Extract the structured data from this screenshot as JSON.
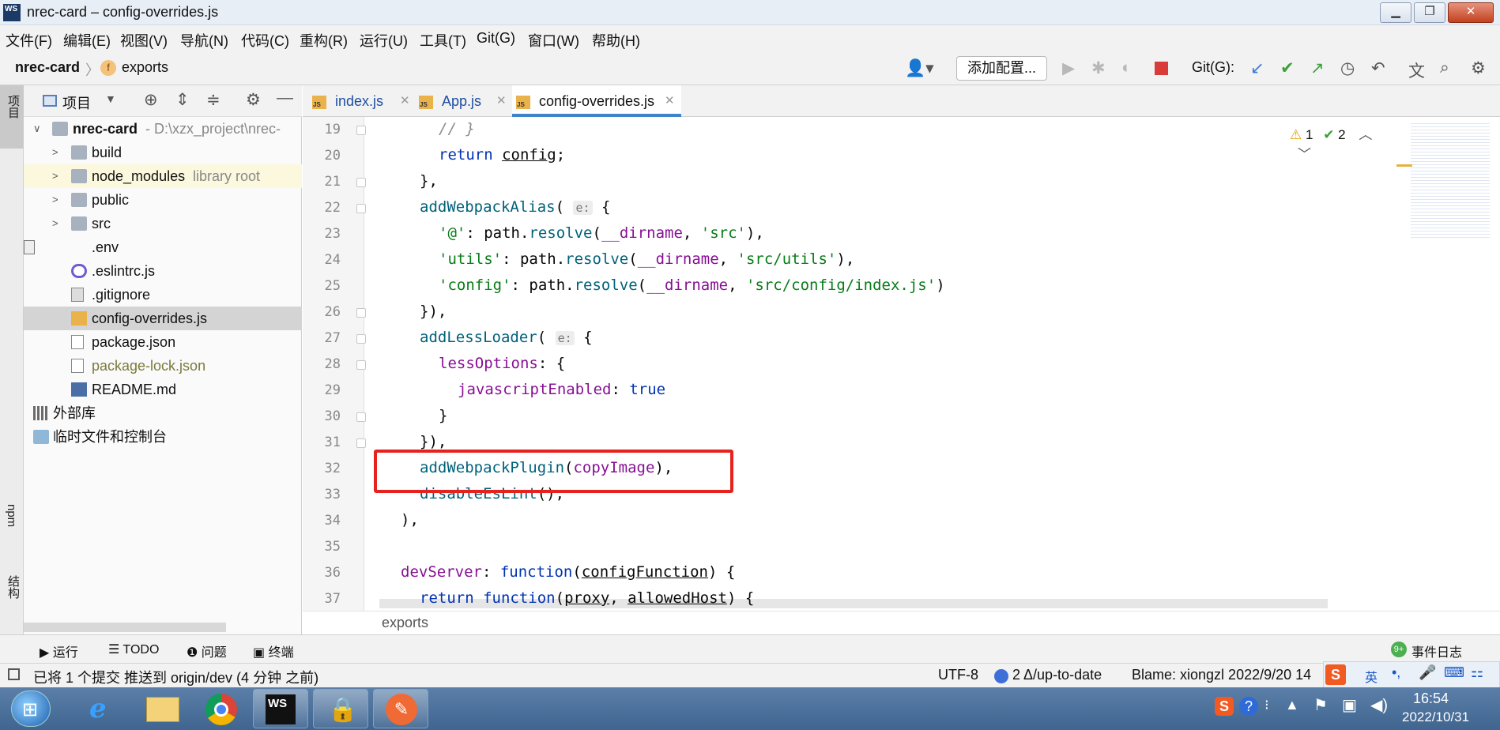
{
  "window": {
    "title": "nrec-card – config-overrides.js"
  },
  "menu": [
    "文件(F)",
    "编辑(E)",
    "视图(V)",
    "导航(N)",
    "代码(C)",
    "重构(R)",
    "运行(U)",
    "工具(T)",
    "Git(G)",
    "窗口(W)",
    "帮助(H)"
  ],
  "nav": {
    "project": "nrec-card",
    "crumb_icon": "f",
    "crumb": "exports",
    "add_config": "添加配置...",
    "git_label": "Git(G):"
  },
  "project_panel": {
    "title": "项目",
    "side_label": "项目",
    "npm_label": "npm",
    "structure_label": "结构"
  },
  "tree": [
    {
      "label": "nrec-card",
      "extra": "- D:\\xzx_project\\nrec-",
      "icon": "folder-icon",
      "depth": 0,
      "chev": "∨"
    },
    {
      "label": "build",
      "extra": "",
      "icon": "folder-icon",
      "depth": 1,
      "chev": ">"
    },
    {
      "label": "node_modules",
      "extra": "library root",
      "icon": "folder-icon",
      "depth": 1,
      "chev": ">",
      "highlight": true
    },
    {
      "label": "public",
      "extra": "",
      "icon": "folder-icon",
      "depth": 1,
      "chev": ">"
    },
    {
      "label": "src",
      "extra": "",
      "icon": "folder-icon",
      "depth": 1,
      "chev": ">"
    },
    {
      "label": ".env",
      "extra": "",
      "icon": "text-file-icon",
      "depth": 1,
      "chev": ""
    },
    {
      "label": ".eslintrc.js",
      "extra": "",
      "icon": "eslint-file-icon",
      "depth": 1,
      "chev": ""
    },
    {
      "label": ".gitignore",
      "extra": "",
      "icon": "ignore-file-icon",
      "depth": 1,
      "chev": ""
    },
    {
      "label": "config-overrides.js",
      "extra": "",
      "icon": "js-file-icon",
      "depth": 1,
      "chev": "",
      "selected": true
    },
    {
      "label": "package.json",
      "extra": "",
      "icon": "json-file-icon",
      "depth": 1,
      "chev": ""
    },
    {
      "label": "package-lock.json",
      "extra": "",
      "icon": "json-file-icon",
      "depth": 1,
      "chev": "",
      "muted": true
    },
    {
      "label": "README.md",
      "extra": "",
      "icon": "markdown-file-icon",
      "depth": 1,
      "chev": ""
    },
    {
      "label": "外部库",
      "extra": "",
      "icon": "library-icon",
      "depth": 0,
      "chev": ""
    },
    {
      "label": "临时文件和控制台",
      "extra": "",
      "icon": "scratches-icon",
      "depth": 0,
      "chev": ""
    }
  ],
  "tabs": [
    {
      "label": "index.js",
      "active": false
    },
    {
      "label": "App.js",
      "active": false
    },
    {
      "label": "config-overrides.js",
      "active": true
    }
  ],
  "inspections": {
    "warnings": "1",
    "typos": "2"
  },
  "lines": [
    {
      "n": "19",
      "code": "// }"
    },
    {
      "n": "20",
      "code": "return config;"
    },
    {
      "n": "21",
      "code": "},"
    },
    {
      "n": "22",
      "code": "addWebpackAlias( e: {"
    },
    {
      "n": "23",
      "code": "'@': path.resolve(__dirname, 'src'),"
    },
    {
      "n": "24",
      "code": "'utils': path.resolve(__dirname, 'src/utils'),"
    },
    {
      "n": "25",
      "code": "'config': path.resolve(__dirname, 'src/config/index.js')"
    },
    {
      "n": "26",
      "code": "}),"
    },
    {
      "n": "27",
      "code": "addLessLoader( e: {"
    },
    {
      "n": "28",
      "code": "lessOptions: {"
    },
    {
      "n": "29",
      "code": "javascriptEnabled: true"
    },
    {
      "n": "30",
      "code": "}"
    },
    {
      "n": "31",
      "code": "}),"
    },
    {
      "n": "32",
      "code": "addWebpackPlugin(copyImage),"
    },
    {
      "n": "33",
      "code": "disableEsLint(),"
    },
    {
      "n": "34",
      "code": "),"
    },
    {
      "n": "35",
      "code": ""
    },
    {
      "n": "36",
      "code": "devServer: function(configFunction) {"
    },
    {
      "n": "37",
      "code": "return function(proxy, allowedHost) {"
    }
  ],
  "editor_crumb": "exports",
  "bottom_tabs": [
    "运行",
    "TODO",
    "问题",
    "终端"
  ],
  "event_log": "事件日志",
  "event_badge": "9+",
  "status": {
    "message": "已将 1 个提交 推送到 origin/dev (4 分钟 之前)",
    "encoding": "UTF-8",
    "git": "2 Δ/up-to-date",
    "blame": "Blame: xiongzl 2022/9/20 14",
    "ime_lang": "英"
  },
  "taskbar": {
    "time": "16:54",
    "date": "2022/10/31"
  },
  "colors": {
    "highlight_box": "#e5221d",
    "keyword": "#0033b3",
    "string": "#067d17",
    "property": "#871094",
    "function": "#00627a"
  }
}
